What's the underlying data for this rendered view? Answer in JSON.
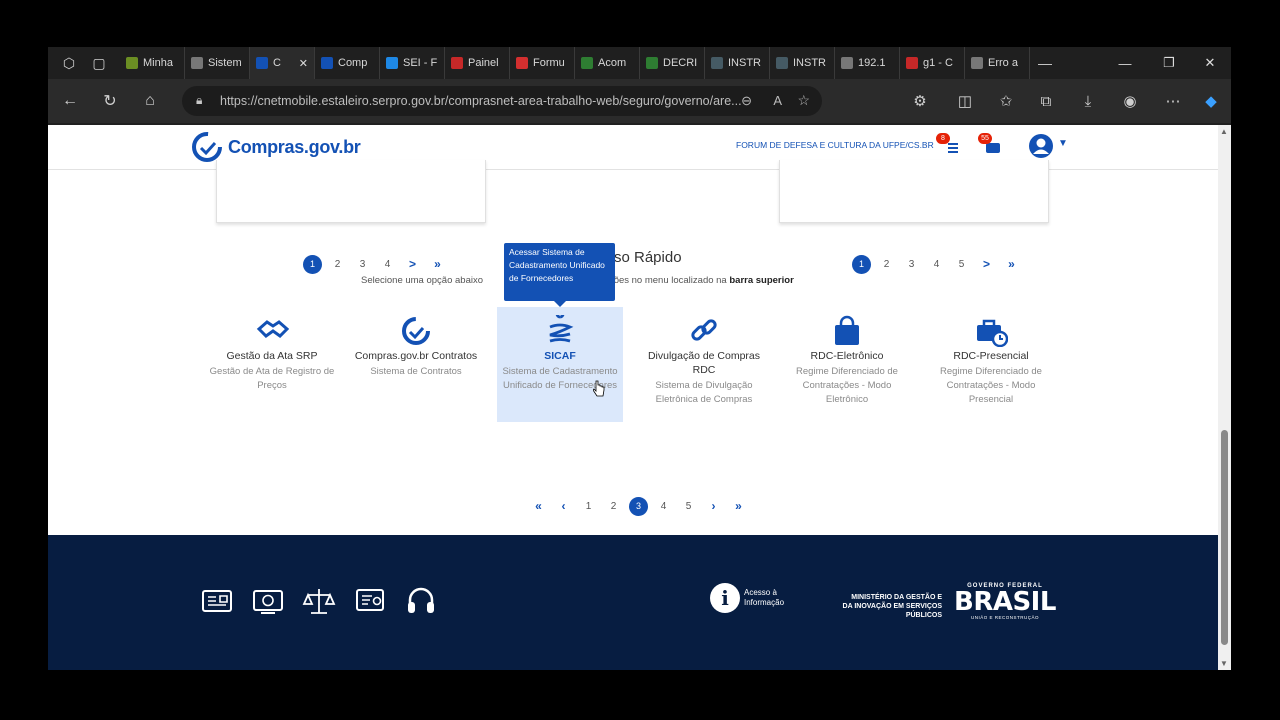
{
  "browser": {
    "tabs": [
      {
        "label": "Minha",
        "color": "#6b8e23"
      },
      {
        "label": "Sistem",
        "color": "#777777"
      },
      {
        "label": "C",
        "color": "#1351b4",
        "active": true
      },
      {
        "label": "Comp",
        "color": "#1351b4"
      },
      {
        "label": "SEI - F",
        "color": "#1e88e5"
      },
      {
        "label": "Painel",
        "color": "#c62828"
      },
      {
        "label": "Formu",
        "color": "#d32f2f"
      },
      {
        "label": "Acom",
        "color": "#2e7d32"
      },
      {
        "label": "DECRI",
        "color": "#2e7d32"
      },
      {
        "label": "INSTR",
        "color": "#455a64"
      },
      {
        "label": "INSTR",
        "color": "#455a64"
      },
      {
        "label": "192.1",
        "color": "#777777"
      },
      {
        "label": "g1 - C",
        "color": "#c62828"
      },
      {
        "label": "Erro a",
        "color": "#777777"
      }
    ],
    "url": "https://cnetmobile.estaleiro.serpro.gov.br/comprasnet-area-trabalho-web/seguro/governo/are..."
  },
  "header": {
    "logo_text": "Compras.gov.br",
    "org_link": "FORUM DE DEFESA E CULTURA DA UFPE/CS.BR",
    "notif_badge_1": "8",
    "notif_badge_2": "55"
  },
  "pagers": {
    "left": [
      "1",
      "2",
      "3",
      "4",
      ">",
      "»"
    ],
    "right": [
      "1",
      "2",
      "3",
      "4",
      "5",
      ">",
      "»"
    ],
    "quick": [
      "«",
      "‹",
      "1",
      "2",
      "3",
      "4",
      "5",
      "›",
      "»"
    ],
    "quick_current": "3"
  },
  "quick_access": {
    "title": "so Rápido",
    "subtitle_prefix": "Selecione uma opção abaixo",
    "subtitle_middle": "acessar essas opções no menu localizado na ",
    "subtitle_bold": "barra superior",
    "tooltip": "Acessar Sistema de Cadastramento Unificado de Fornecedores",
    "items": [
      {
        "name": "Gestão da Ata SRP",
        "desc": "Gestão de Ata de Registro de Preços",
        "icon": "handshake-icon"
      },
      {
        "name": "Compras.gov.br Contratos",
        "desc": "Sistema de Contratos",
        "icon": "compras-logo-icon"
      },
      {
        "name": "SICAF",
        "desc": "Sistema de Cadastramento Unificado de Fornecedores",
        "icon": "sicaf-icon"
      },
      {
        "name": "Divulgação de Compras RDC",
        "desc": "Sistema de Divulgação Eletrônica de Compras",
        "icon": "link-icon"
      },
      {
        "name": "RDC-Eletrônico",
        "desc": "Regime Diferenciado de Contratações - Modo Eletrônico",
        "icon": "shopping-bag-icon"
      },
      {
        "name": "RDC-Presencial",
        "desc": "Regime Diferenciado de Contratações - Modo Presencial",
        "icon": "briefcase-clock-icon"
      }
    ]
  },
  "footer": {
    "access_info": "Acesso à Informação",
    "ministry": "MINISTÉRIO DA GESTÃO E DA INOVAÇÃO EM SERVIÇOS PÚBLICOS",
    "gov_label": "GOVERNO FEDERAL",
    "brasil": "BRASIL",
    "brasil_sub": "UNIÃO E RECONSTRUÇÃO"
  },
  "colors": {
    "primary": "#1351b4",
    "footer_bg": "#071d41",
    "badge": "#e52207"
  }
}
